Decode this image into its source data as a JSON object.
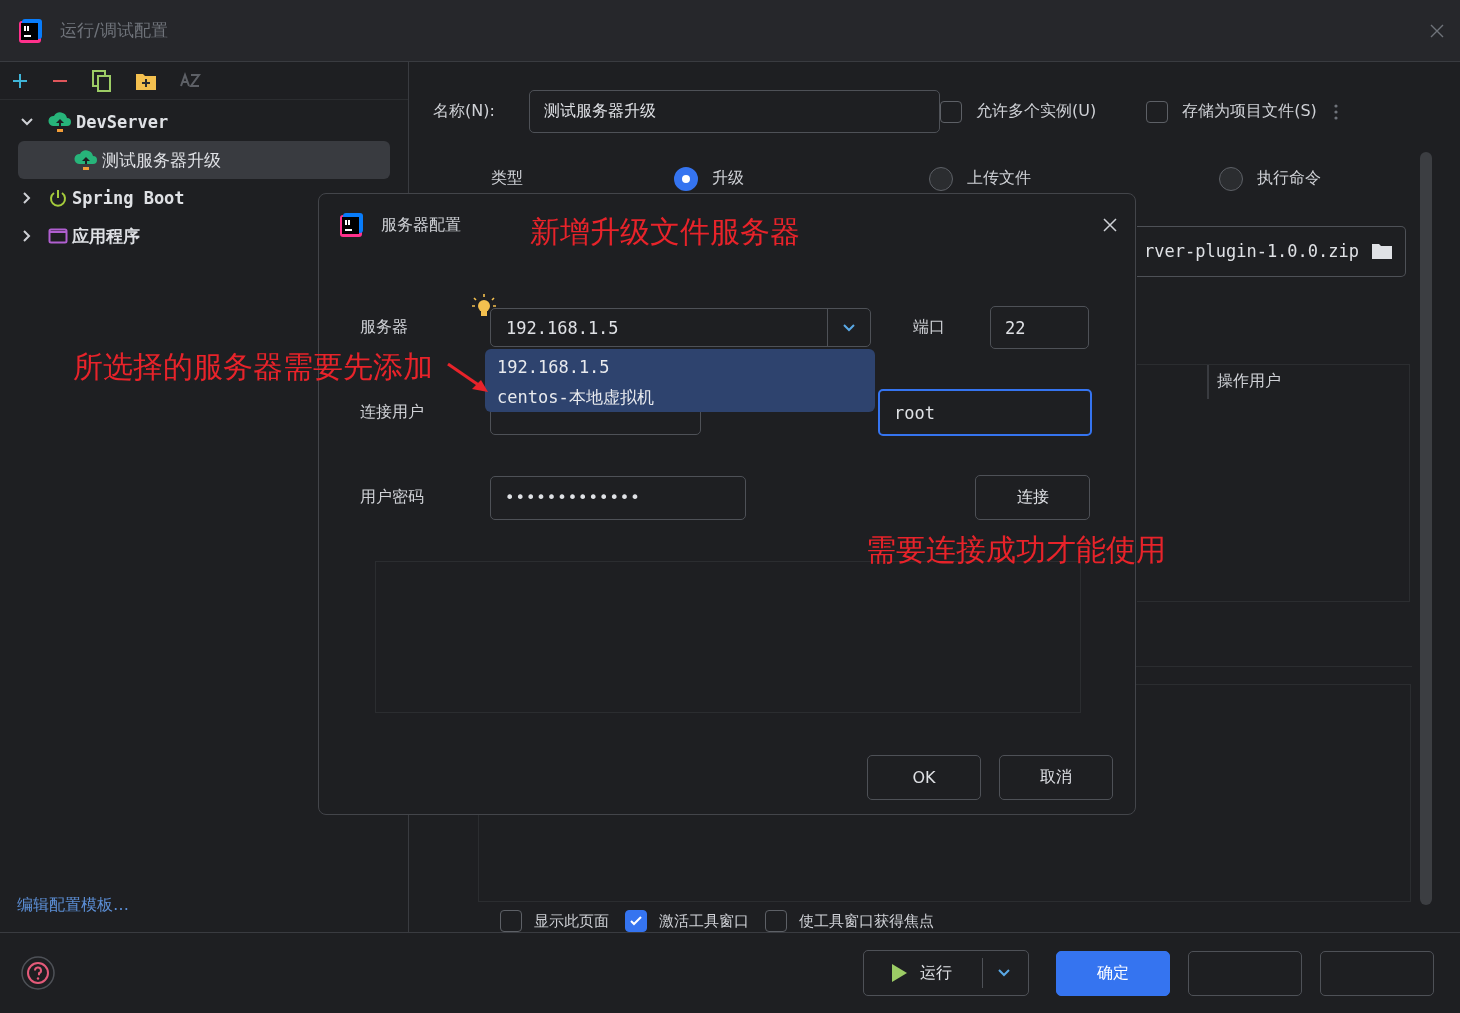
{
  "window": {
    "title": "运行/调试配置"
  },
  "tree": [
    {
      "label": "DevServer",
      "kind": "server",
      "expanded": true,
      "selected": false,
      "children": [
        {
          "label": "测试服务器升级",
          "kind": "server",
          "selected": true
        }
      ]
    },
    {
      "label": "Spring Boot",
      "kind": "spring",
      "expanded": false,
      "selected": false
    },
    {
      "label": "应用程序",
      "kind": "app",
      "expanded": false,
      "selected": false
    }
  ],
  "edit_templates_link": "编辑配置模板…",
  "config": {
    "name_label": "名称(N):",
    "name_value": "测试服务器升级",
    "options": [
      {
        "label": "允许多个实例(U)",
        "checked": false
      },
      {
        "label": "存储为项目文件(S)",
        "checked": false
      }
    ],
    "type_label": "类型",
    "types": [
      {
        "label": "升级",
        "selected": true
      },
      {
        "label": "上传文件",
        "selected": false
      },
      {
        "label": "执行命令",
        "selected": false
      }
    ],
    "file_path": "rver-plugin-1.0.0.zip",
    "table_header": "操作用户",
    "launch_options": [
      {
        "label": "显示此页面",
        "checked": false
      },
      {
        "label": "激活工具窗口",
        "checked": true
      },
      {
        "label": "使工具窗口获得焦点",
        "checked": false
      }
    ]
  },
  "dialog": {
    "title": "服务器配置",
    "server_label": "服务器",
    "server_value": "192.168.1.5",
    "server_options": [
      {
        "label": "192.168.1.5"
      },
      {
        "label": "centos-本地虚拟机"
      }
    ],
    "port_label": "端口",
    "port_value": "22",
    "user_label": "连接用户",
    "operator_value": "root",
    "password_label": "用户密码",
    "password_value": "•••••••••••••",
    "connect_button": "连接",
    "ok_button": "OK",
    "cancel_button": "取消"
  },
  "footer": {
    "run_button": "运行",
    "confirm_button": "确定"
  },
  "annotations": [
    {
      "text": "新增升级文件服务器"
    },
    {
      "text": "所选择的服务器需要先添加"
    },
    {
      "text": "需要连接成功才能使用"
    }
  ]
}
